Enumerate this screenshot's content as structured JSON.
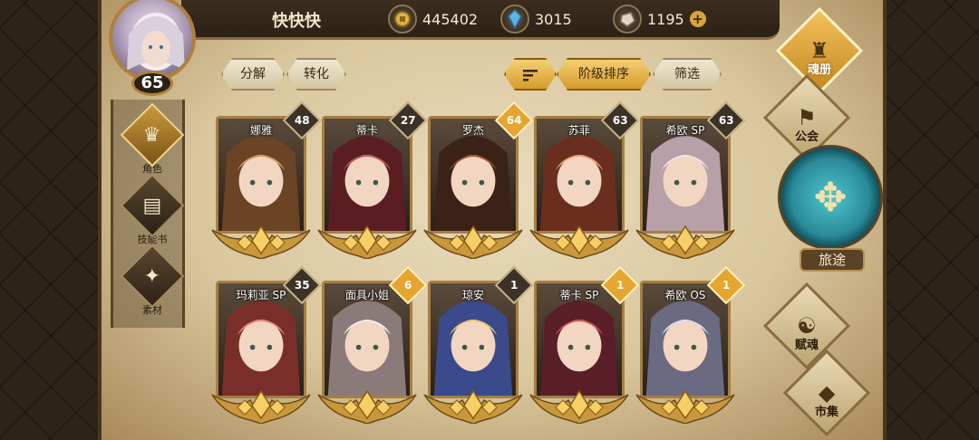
{
  "player": {
    "name": "快快快",
    "level": "65"
  },
  "resources": [
    {
      "icon": "gold-coin-icon",
      "value": "445402"
    },
    {
      "icon": "blue-crystal-icon",
      "value": "3015"
    },
    {
      "icon": "stone-gem-icon",
      "value": "1195"
    }
  ],
  "toolbar": {
    "decompose": "分解",
    "convert": "转化",
    "sort": "阶级排序",
    "filter": "筛选"
  },
  "left_nav": [
    {
      "label": "角色",
      "icon": "helmet-icon",
      "active": true
    },
    {
      "label": "技能书",
      "icon": "skill-book-icon",
      "active": false
    },
    {
      "label": "素材",
      "icon": "material-icon",
      "active": false
    }
  ],
  "right_nav": {
    "soul_book": "魂册",
    "guild": "公会",
    "journey": "旅途",
    "talent": "赋魂",
    "market": "市集"
  },
  "heroes": [
    {
      "name": "娜雅",
      "count": "48",
      "gold": false,
      "colors": [
        "#c89a5a",
        "#6a4424"
      ]
    },
    {
      "name": "蒂卡",
      "count": "27",
      "gold": false,
      "colors": [
        "#c0585a",
        "#5a1e22"
      ]
    },
    {
      "name": "罗杰",
      "count": "64",
      "gold": true,
      "colors": [
        "#9a4a30",
        "#3a2216"
      ]
    },
    {
      "name": "苏菲",
      "count": "63",
      "gold": false,
      "colors": [
        "#e8a070",
        "#6a2e1e"
      ]
    },
    {
      "name": "希欧 SP",
      "count": "63",
      "gold": false,
      "colors": [
        "#f2e4e0",
        "#b8a0a8"
      ]
    },
    {
      "name": "玛莉亚 SP",
      "count": "35",
      "gold": false,
      "colors": [
        "#e68a7a",
        "#7a2e2a"
      ]
    },
    {
      "name": "面具小姐",
      "count": "6",
      "gold": true,
      "colors": [
        "#f0ecee",
        "#8a7a7a"
      ]
    },
    {
      "name": "琼安",
      "count": "1",
      "gold": false,
      "colors": [
        "#e8c870",
        "#3a4a8a"
      ]
    },
    {
      "name": "蒂卡 SP",
      "count": "1",
      "gold": true,
      "colors": [
        "#d0505a",
        "#5a1e28"
      ]
    },
    {
      "name": "希欧 OS",
      "count": "1",
      "gold": true,
      "colors": [
        "#dcdcea",
        "#6a6a82"
      ]
    }
  ]
}
